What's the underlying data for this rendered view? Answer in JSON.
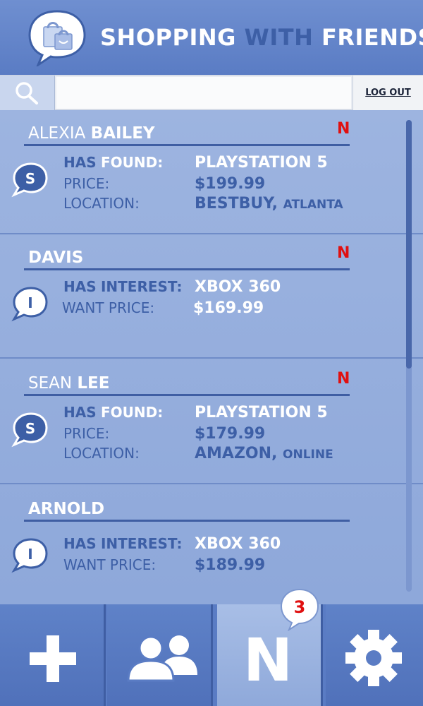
{
  "header": {
    "title_part1": "SHOPPING",
    "title_part2": "WITH",
    "title_part3": "FRIENDS"
  },
  "search": {
    "value": "",
    "placeholder": ""
  },
  "logout_label": "LOG OUT",
  "cards": [
    {
      "first": "ALEXIA",
      "last": "BAILEY",
      "new_badge": "N",
      "bubble_letter": "S",
      "row1_label_a": "HAS",
      "row1_label_b": "FOUND:",
      "row1_value": "PLAYSTATION 5",
      "row2_label": "PRICE:",
      "row2_value": "$199.99",
      "row3_label": "LOCATION:",
      "row3_value": "BESTBUY,",
      "row3_small": "ATLANTA"
    },
    {
      "first": "",
      "last": "DAVIS",
      "new_badge": "N",
      "bubble_letter": "I",
      "row1_label_a": "HAS",
      "row1_label_b": "INTEREST:",
      "row1_value": "XBOX 360",
      "row2_label": "WANT PRICE:",
      "row2_value": "$169.99"
    },
    {
      "first": "SEAN",
      "last": "LEE",
      "new_badge": "N",
      "bubble_letter": "S",
      "row1_label_a": "HAS",
      "row1_label_b": "FOUND:",
      "row1_value": "PLAYSTATION 5",
      "row2_label": "PRICE:",
      "row2_value": "$179.99",
      "row3_label": "LOCATION:",
      "row3_value": "AMAZON,",
      "row3_small": "ONLINE"
    },
    {
      "first": "",
      "last": "ARNOLD",
      "bubble_letter": "I",
      "row1_label_a": "HAS",
      "row1_label_b": "INTEREST:",
      "row1_value": "XBOX 360",
      "row2_label": "WANT PRICE:",
      "row2_value": "$189.99"
    }
  ],
  "tabs": {
    "add_icon": "plus-icon",
    "friends_icon": "friends-icon",
    "notifications_letter": "N",
    "notifications_count": "3",
    "settings_icon": "gear-icon"
  },
  "colors": {
    "brand_blue": "#5a7cc4",
    "dark_blue": "#3d5fa6",
    "alert_red": "#e01010"
  }
}
